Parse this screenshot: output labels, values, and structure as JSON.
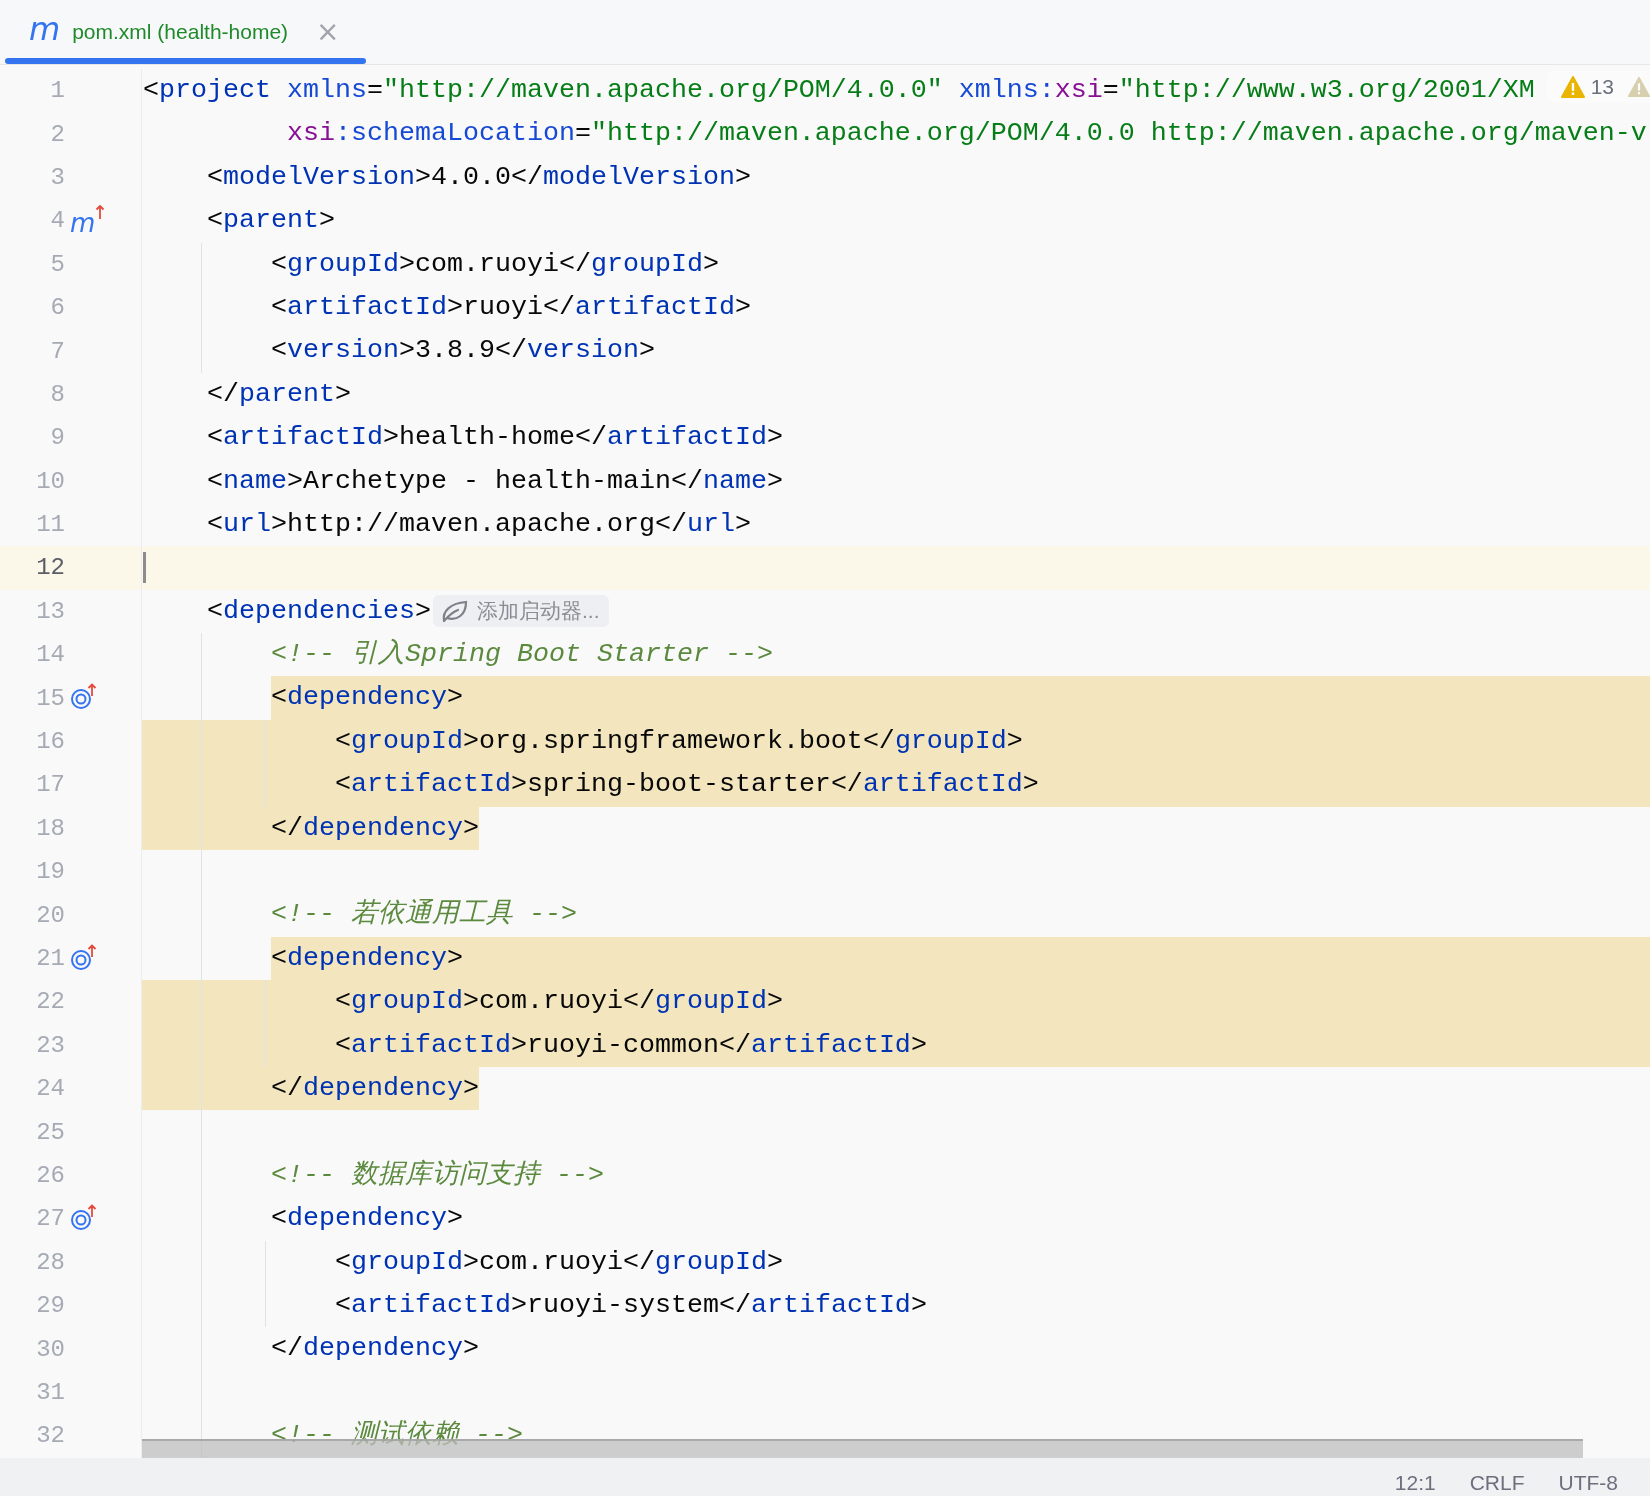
{
  "tab": {
    "icon": "m",
    "label": "pom.xml (health-home)",
    "close": "×",
    "selected": true
  },
  "inspections": {
    "count": "13"
  },
  "lines": [
    {
      "number": "1",
      "current": false,
      "highlighted": false,
      "code": "<project xmlns=\"http://maven.apache.org/POM/4.0.0\" xmlns:xsi=\"http://www.w3.org/2001/XM"
    },
    {
      "number": "2",
      "current": false,
      "highlighted": false,
      "code": "         xsi:schemaLocation=\"http://maven.apache.org/POM/4.0.0 http://maven.apache.org/maven-v"
    },
    {
      "number": "3",
      "current": false,
      "highlighted": false,
      "code": "    <modelVersion>4.0.0</modelVersion>"
    },
    {
      "number": "4",
      "current": false,
      "highlighted": false,
      "gutter": {
        "kind": "parent",
        "glyph": "m"
      },
      "code": "    <parent>"
    },
    {
      "number": "5",
      "current": false,
      "highlighted": false,
      "code": "        <groupId>com.ruoyi</groupId>"
    },
    {
      "number": "6",
      "current": false,
      "highlighted": false,
      "code": "        <artifactId>ruoyi</artifactId>"
    },
    {
      "number": "7",
      "current": false,
      "highlighted": false,
      "code": "        <version>3.8.9</version>"
    },
    {
      "number": "8",
      "current": false,
      "highlighted": false,
      "code": "    </parent>"
    },
    {
      "number": "9",
      "current": false,
      "highlighted": false,
      "code": "    <artifactId>health-home</artifactId>"
    },
    {
      "number": "10",
      "current": false,
      "highlighted": false,
      "code": "    <name>Archetype - health-main</name>"
    },
    {
      "number": "11",
      "current": false,
      "highlighted": false,
      "code": "    <url>http://maven.apache.org</url>"
    },
    {
      "number": "12",
      "current": true,
      "highlighted": false
    },
    {
      "number": "13",
      "current": false,
      "highlighted": false,
      "code": "    <dependencies>",
      "hint": "添加启动器..."
    },
    {
      "number": "14",
      "current": false,
      "highlighted": false,
      "code": "        <!-- 引入Spring Boot Starter -->"
    },
    {
      "number": "15",
      "current": false,
      "highlighted": true,
      "gutter": {
        "kind": "override"
      },
      "code": "        <dependency>"
    },
    {
      "number": "16",
      "current": false,
      "highlighted": true,
      "code": "            <groupId>org.springframework.boot</groupId>"
    },
    {
      "number": "17",
      "current": false,
      "highlighted": true,
      "code": "            <artifactId>spring-boot-starter</artifactId>"
    },
    {
      "number": "18",
      "current": false,
      "highlighted": true,
      "code": "        </dependency>"
    },
    {
      "number": "19",
      "current": false,
      "highlighted": false
    },
    {
      "number": "20",
      "current": false,
      "highlighted": false,
      "code": "        <!-- 若依通用工具 -->"
    },
    {
      "number": "21",
      "current": false,
      "highlighted": true,
      "gutter": {
        "kind": "override"
      },
      "code": "        <dependency>"
    },
    {
      "number": "22",
      "current": false,
      "highlighted": true,
      "code": "            <groupId>com.ruoyi</groupId>"
    },
    {
      "number": "23",
      "current": false,
      "highlighted": true,
      "code": "            <artifactId>ruoyi-common</artifactId>"
    },
    {
      "number": "24",
      "current": false,
      "highlighted": true,
      "code": "        </dependency>"
    },
    {
      "number": "25",
      "current": false,
      "highlighted": false
    },
    {
      "number": "26",
      "current": false,
      "highlighted": false,
      "code": "        <!-- 数据库访问支持 -->"
    },
    {
      "number": "27",
      "current": false,
      "highlighted": false,
      "gutter": {
        "kind": "override"
      },
      "code": "        <dependency>"
    },
    {
      "number": "28",
      "current": false,
      "highlighted": false,
      "code": "            <groupId>com.ruoyi</groupId>"
    },
    {
      "number": "29",
      "current": false,
      "highlighted": false,
      "code": "            <artifactId>ruoyi-system</artifactId>"
    },
    {
      "number": "30",
      "current": false,
      "highlighted": false,
      "code": "        </dependency>"
    },
    {
      "number": "31",
      "current": false,
      "highlighted": false
    },
    {
      "number": "32",
      "current": false,
      "highlighted": false,
      "code": "        <!-- 测试依赖 -->"
    }
  ],
  "status_bar": {
    "caret_position": "12:1",
    "line_separator": "CRLF",
    "encoding": "UTF-8"
  }
}
